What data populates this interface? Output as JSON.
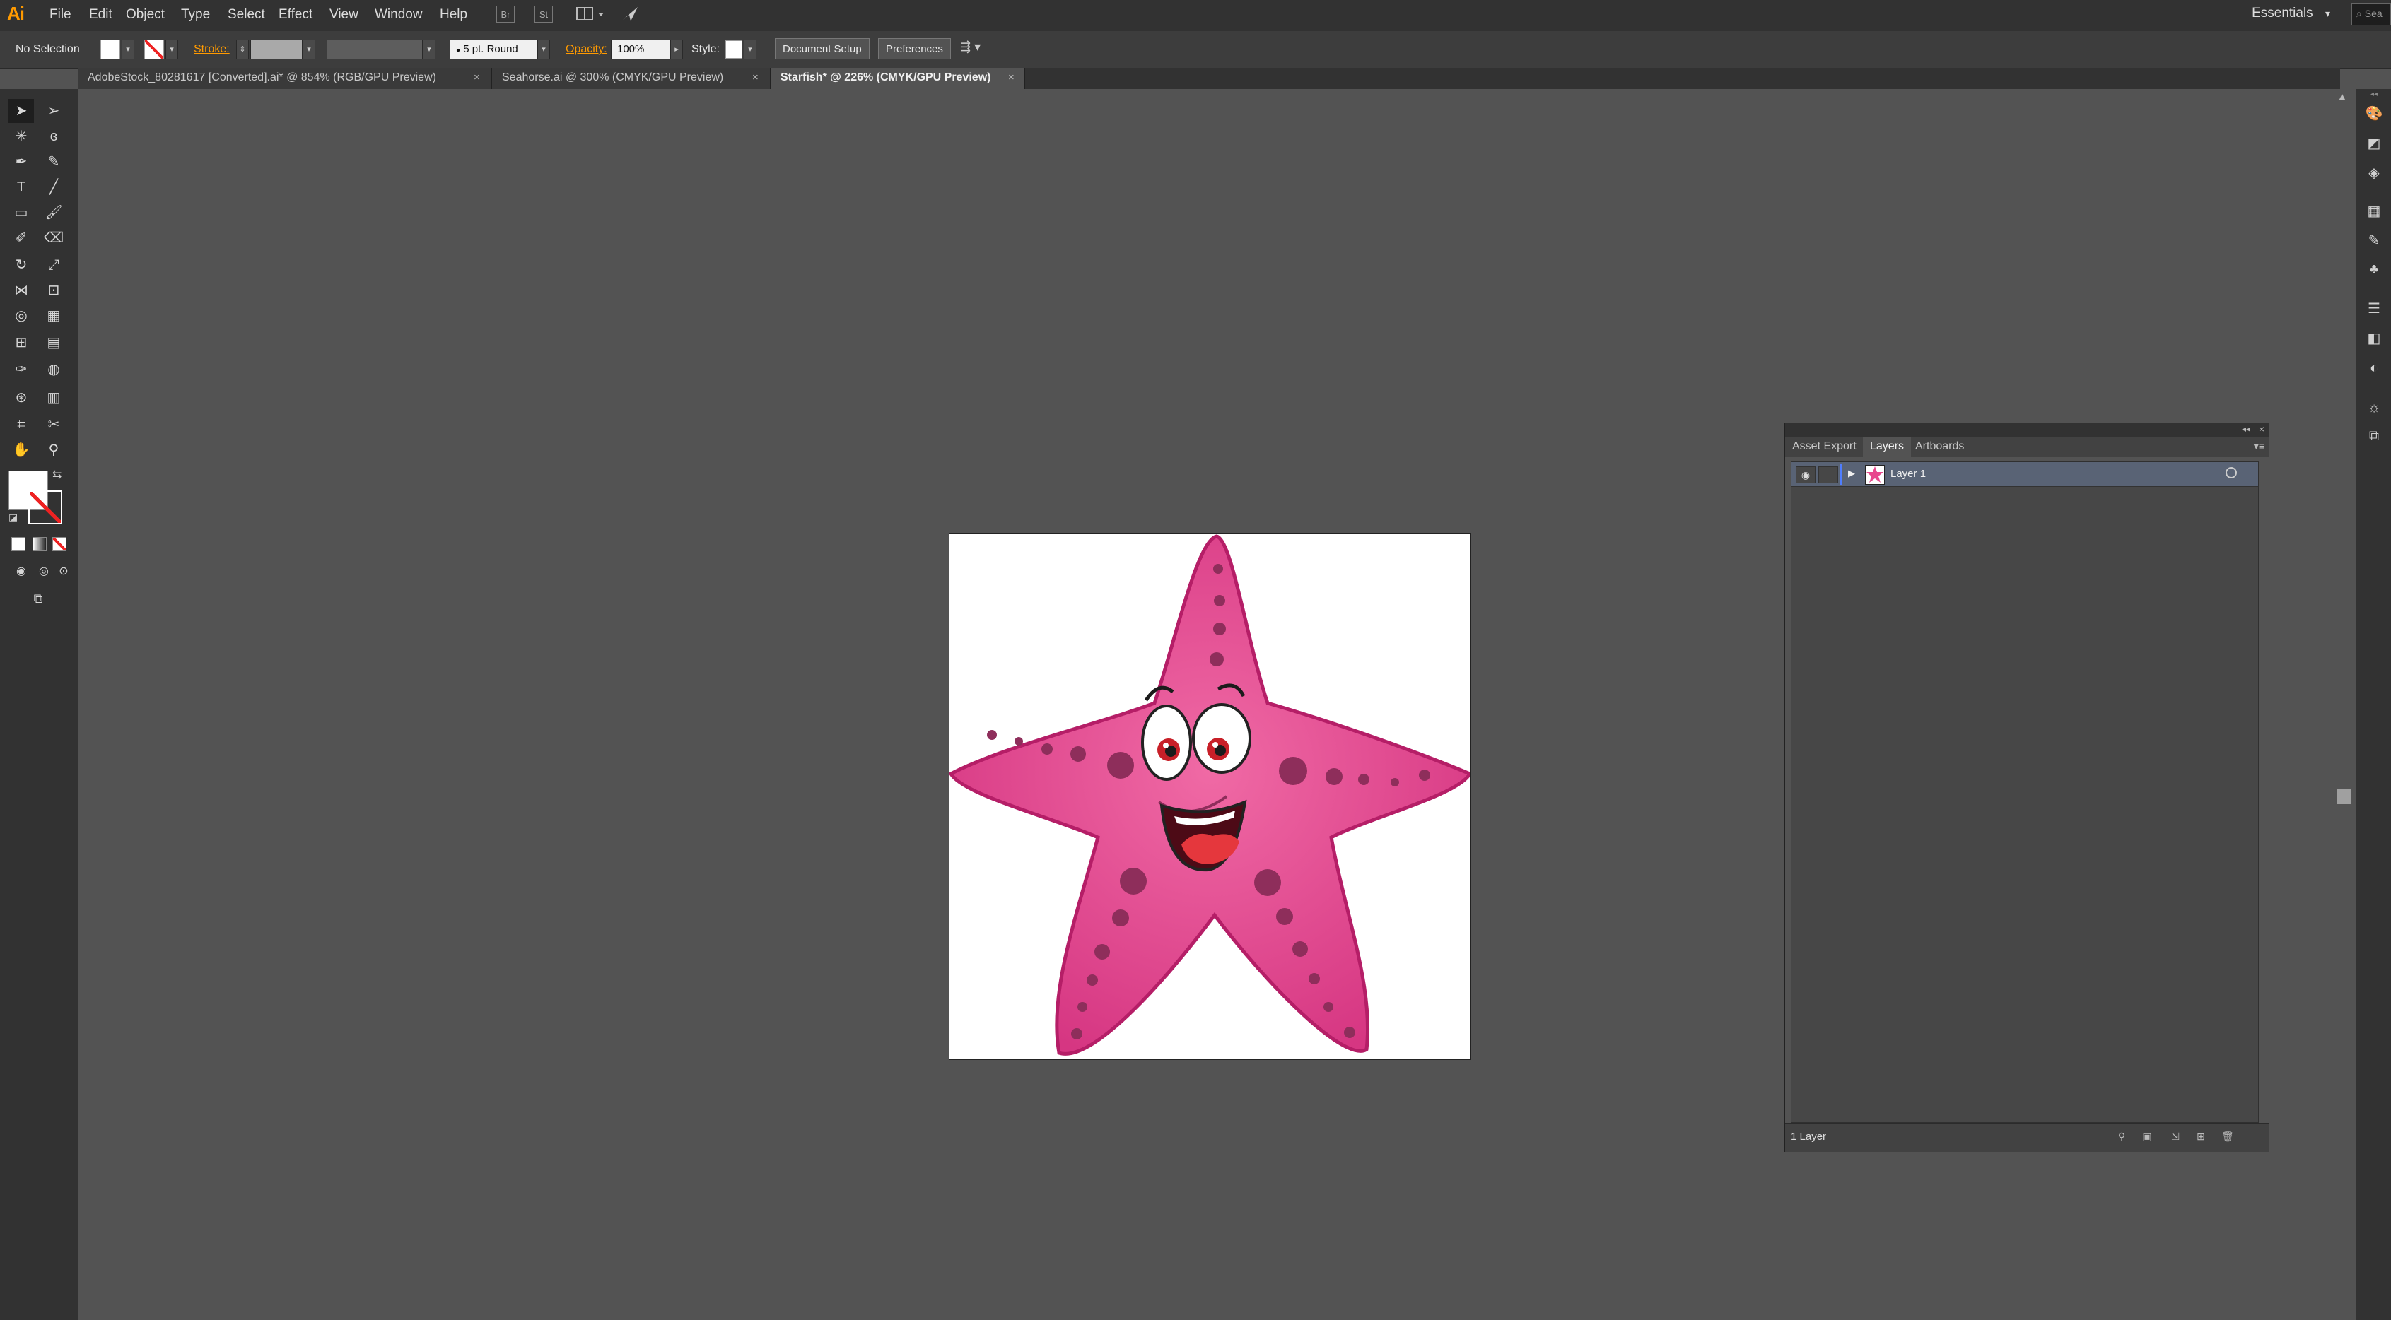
{
  "app": {
    "logo": "Ai"
  },
  "menu": {
    "items": [
      "File",
      "Edit",
      "Object",
      "Type",
      "Select",
      "Effect",
      "View",
      "Window",
      "Help"
    ]
  },
  "menubar_icons": {
    "bridge": "Br",
    "stock": "St",
    "arrange": "arrange-documents-icon",
    "gpu": "gpu-performance-icon"
  },
  "workspace": {
    "label": "Essentials"
  },
  "search": {
    "placeholder": "Sea"
  },
  "control": {
    "selection": "No Selection",
    "stroke_label": "Stroke:",
    "brush_label": "5 pt. Round",
    "opacity_label": "Opacity:",
    "opacity_value": "100%",
    "style_label": "Style:",
    "doc_setup": "Document Setup",
    "preferences": "Preferences"
  },
  "tabs": [
    {
      "label": "AdobeStock_80281617 [Converted].ai* @ 854% (RGB/GPU Preview)",
      "close": "×"
    },
    {
      "label": "Seahorse.ai @ 300% (CMYK/GPU Preview)",
      "close": "×"
    },
    {
      "label": "Starfish* @ 226% (CMYK/GPU Preview)",
      "close": "×"
    }
  ],
  "panel": {
    "tabs": [
      "Asset Export",
      "Layers",
      "Artboards"
    ],
    "layer_name": "Layer 1",
    "footer": "1 Layer"
  },
  "colors": {
    "accent": "#ff9a00",
    "starfish_pink": "#e8478d",
    "starfish_spots": "#8e2e5b"
  }
}
